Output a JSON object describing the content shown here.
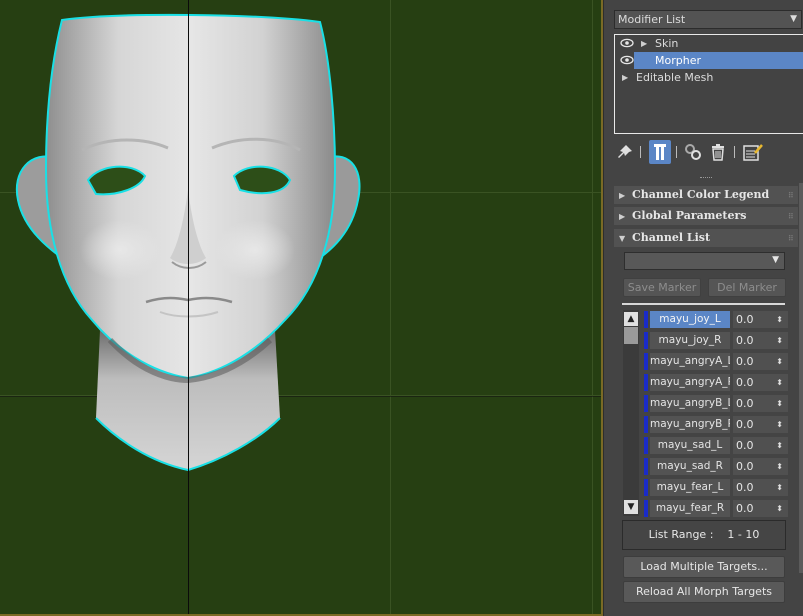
{
  "modifier_list": {
    "label": "Modifier List"
  },
  "stack": {
    "items": [
      {
        "label": "Skin"
      },
      {
        "label": "Morpher"
      },
      {
        "label": "Editable Mesh"
      }
    ]
  },
  "toolbar": {
    "icons": [
      "pin-stack-icon",
      "show-end-result-icon",
      "make-unique-icon",
      "remove-modifier-icon",
      "configure-modifier-sets-icon"
    ]
  },
  "rollouts": {
    "channel_color_legend": "Channel Color Legend",
    "global_parameters": "Global Parameters",
    "channel_list": "Channel List"
  },
  "markers": {
    "save_label": "Save Marker",
    "delete_label": "Del Marker"
  },
  "channels": [
    {
      "name": "mayu_joy_L",
      "value": "0.0"
    },
    {
      "name": "mayu_joy_R",
      "value": "0.0"
    },
    {
      "name": "mayu_angryA_L",
      "value": "0.0"
    },
    {
      "name": "mayu_angryA_R",
      "value": "0.0"
    },
    {
      "name": "mayu_angryB_L",
      "value": "0.0"
    },
    {
      "name": "mayu_angryB_R",
      "value": "0.0"
    },
    {
      "name": "mayu_sad_L",
      "value": "0.0"
    },
    {
      "name": "mayu_sad_R",
      "value": "0.0"
    },
    {
      "name": "mayu_fear_L",
      "value": "0.0"
    },
    {
      "name": "mayu_fear_R",
      "value": "0.0"
    }
  ],
  "list_range": {
    "label": "List Range :",
    "value": "1 - 10"
  },
  "buttons": {
    "load_multiple": "Load Multiple Targets...",
    "reload_all": "Reload All Morph Targets"
  },
  "colors": {
    "viewport_bg": "#263f12",
    "selection_outline": "#19e0e6",
    "highlight": "#5b86c6",
    "channel_color": "#1a2bc8"
  }
}
